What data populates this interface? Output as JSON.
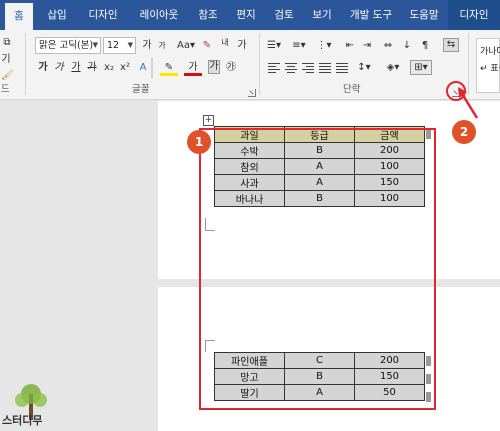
{
  "ribbon_tabs": [
    "홈",
    "삽입",
    "디자인",
    "레이아웃",
    "참조",
    "편지",
    "검토",
    "보기",
    "개발 도구",
    "도움말",
    "디자인"
  ],
  "font": {
    "name": "맑은 고딕(본)",
    "size": "12",
    "group_label": "글꼴"
  },
  "clipboard": {
    "group_label": "드"
  },
  "paragraph": {
    "group_label": "단락"
  },
  "styles": {
    "preview_1": "가나다.",
    "preview_2": "↵ 표준"
  },
  "annotations": {
    "badge_1": "1",
    "badge_2": "2"
  },
  "table_top": {
    "headers": [
      "과일",
      "등급",
      "금액"
    ],
    "rows": [
      [
        "수박",
        "B",
        "200"
      ],
      [
        "참외",
        "A",
        "100"
      ],
      [
        "사과",
        "A",
        "150"
      ],
      [
        "바나나",
        "B",
        "100"
      ]
    ]
  },
  "table_bottom": {
    "rows": [
      [
        "파인애플",
        "C",
        "200"
      ],
      [
        "망고",
        "B",
        "150"
      ],
      [
        "딸기",
        "A",
        "50"
      ]
    ]
  },
  "watermark": "스터디무",
  "colors": {
    "ribbon_blue": "#2b579a",
    "highlight_red": "#e0262f",
    "badge_orange": "#e0512a",
    "header_cell": "#d4d0a0"
  }
}
